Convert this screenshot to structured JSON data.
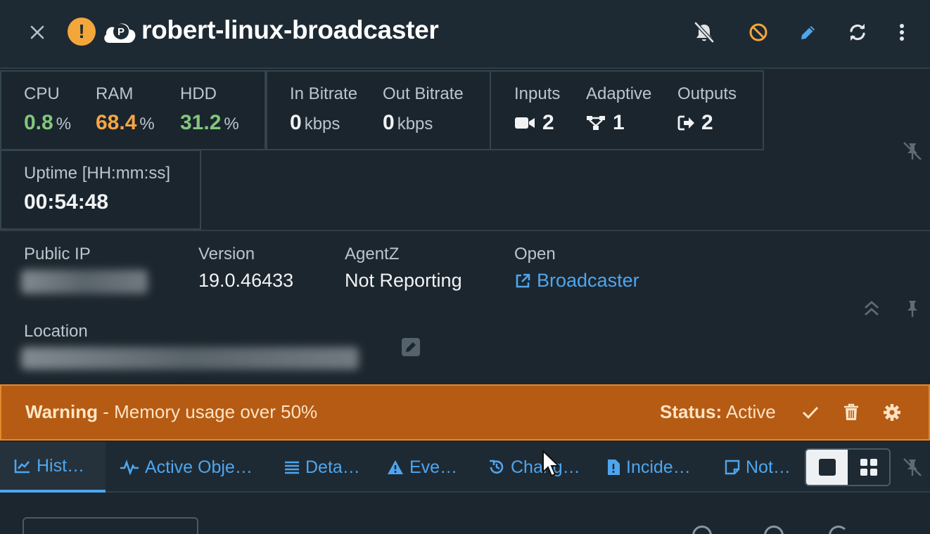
{
  "header": {
    "title": "robert-linux-broadcaster",
    "warning_glyph": "!",
    "cloud_letter": "P",
    "icons": {
      "close": "close-icon",
      "warning": "warning-icon",
      "cloud": "cloud-icon",
      "notifications_off": "bell-slash-icon",
      "ban": "ban-icon",
      "edit": "pencil-icon",
      "refresh": "refresh-icon",
      "more": "more-vertical-icon"
    }
  },
  "stats": {
    "cpu": {
      "label": "CPU",
      "value": "0.8",
      "unit": "%"
    },
    "ram": {
      "label": "RAM",
      "value": "68.4",
      "unit": "%"
    },
    "hdd": {
      "label": "HDD",
      "value": "31.2",
      "unit": "%"
    },
    "in_bitrate": {
      "label": "In Bitrate",
      "value": "0",
      "unit": "kbps"
    },
    "out_bitrate": {
      "label": "Out Bitrate",
      "value": "0",
      "unit": "kbps"
    },
    "inputs": {
      "label": "Inputs",
      "value": "2",
      "icon": "video-camera-icon"
    },
    "adaptive": {
      "label": "Adaptive",
      "value": "1",
      "icon": "network-icon"
    },
    "outputs": {
      "label": "Outputs",
      "value": "2",
      "icon": "sign-out-icon"
    },
    "uptime": {
      "label": "Uptime [HH:mm:ss]",
      "value": "00:54:48"
    }
  },
  "info": {
    "public_ip": {
      "label": "Public IP"
    },
    "version": {
      "label": "Version",
      "value": "19.0.46433"
    },
    "agentz": {
      "label": "AgentZ",
      "value": "Not Reporting"
    },
    "open": {
      "label": "Open",
      "link": "Broadcaster"
    },
    "location": {
      "label": "Location"
    }
  },
  "banner": {
    "level": "Warning",
    "message": " - Memory usage over 50%",
    "status_label": "Status:",
    "status_value": " Active"
  },
  "tabs": [
    {
      "label": "Hist…",
      "icon": "line-chart-icon",
      "active": true
    },
    {
      "label": "Active Obje…",
      "icon": "heartbeat-icon",
      "active": false
    },
    {
      "label": "Deta…",
      "icon": "list-icon",
      "active": false
    },
    {
      "label": "Eve…",
      "icon": "warning-triangle-icon",
      "active": false
    },
    {
      "label": "Chang…",
      "icon": "history-icon",
      "active": false
    },
    {
      "label": "Incide…",
      "icon": "file-alert-icon",
      "active": false
    },
    {
      "label": "Not…",
      "icon": "sticky-note-icon",
      "active": false
    }
  ],
  "colors": {
    "background": "#1c262e",
    "accent": "#4ea6ef",
    "good": "#82c77d",
    "warn": "#f5a644",
    "banner": "#b55b13"
  }
}
